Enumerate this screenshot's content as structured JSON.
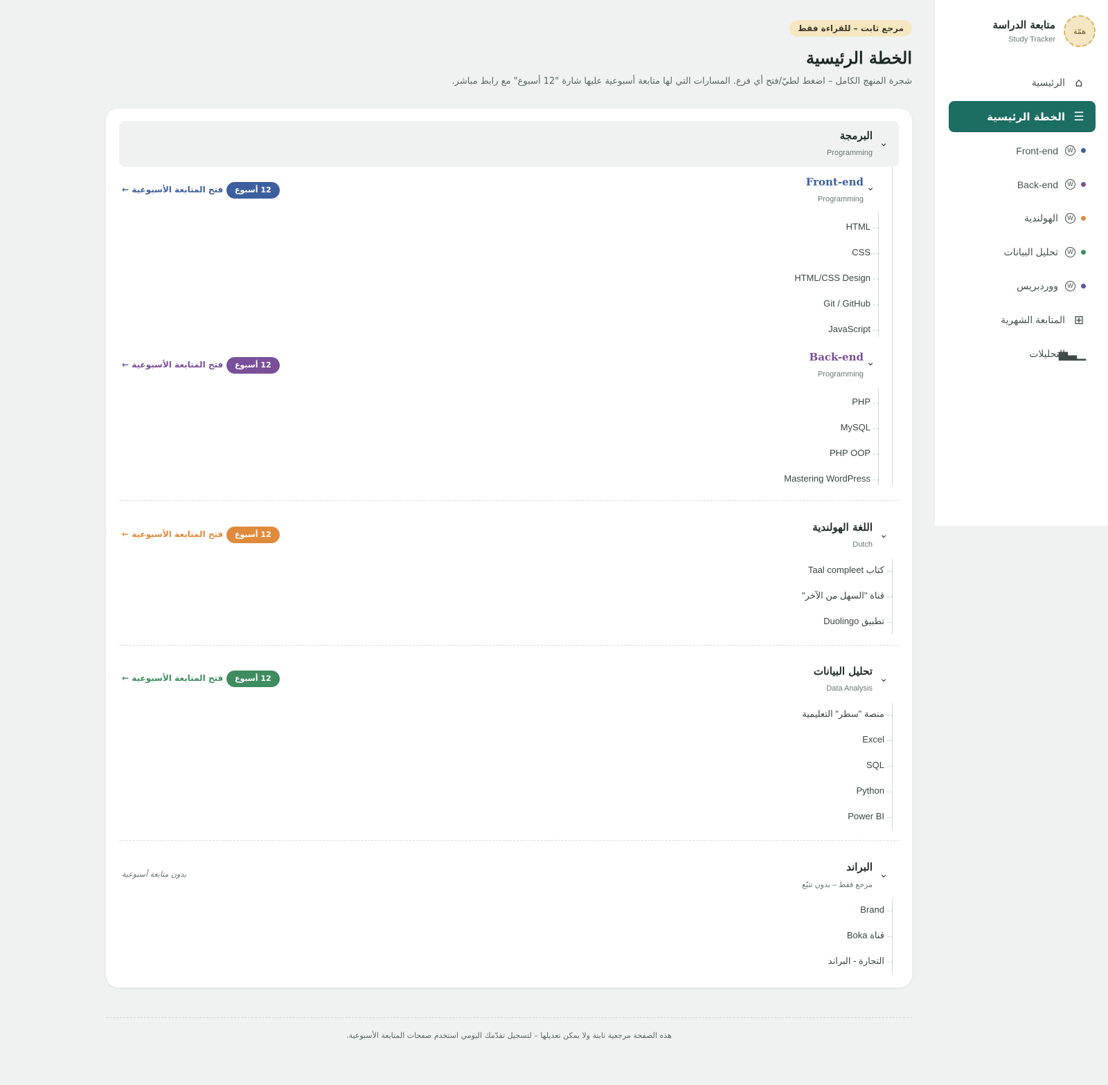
{
  "brand": {
    "logo_text": "همّة",
    "title": "متابعة الدراسة",
    "subtitle": "Study Tracker"
  },
  "nav": [
    {
      "label": "الرئيسية",
      "icon": "home-icon",
      "active": false
    },
    {
      "label": "الخطة الرئيسية",
      "icon": "list-icon",
      "active": true
    },
    {
      "label": "Front-end",
      "icon": "wordpress-icon",
      "dot": "#3d5f9f"
    },
    {
      "label": "Back-end",
      "icon": "wordpress-icon",
      "dot": "#7a4f9a"
    },
    {
      "label": "الهولندية",
      "icon": "wordpress-icon",
      "dot": "#e08a3c"
    },
    {
      "label": "تحليل البيانات",
      "icon": "wordpress-icon",
      "dot": "#3e8c5f"
    },
    {
      "label": "ووردبريس",
      "icon": "wordpress-icon",
      "dot": "#5a56a0"
    },
    {
      "label": "المتابعة الشهرية",
      "icon": "grid-icon"
    },
    {
      "label": "التحليلات",
      "icon": "bar-chart-icon"
    }
  ],
  "header": {
    "badge": "مرجع ثابت – للقراءة فقط",
    "title": "الخطة الرئيسية",
    "description": "شجرة المنهج الكامل – اضغط لطيّ/فتح أي فرع. المسارات التي لها متابعة أسبوعية عليها شارة \"12 أسبوع\" مع رابط مباشر."
  },
  "colors": {
    "accent": "#1c6d62",
    "frontend": "#3d5f9f",
    "backend": "#7a4f9a",
    "dutch": "#e08a3c",
    "data": "#3e8c5f"
  },
  "tree": {
    "programming": {
      "title": "البرمجة",
      "subtitle": "Programming",
      "frontend": {
        "title": "Front-end",
        "subtitle": "Programming",
        "badge": "12 أسبوع",
        "link": "فتح المتابعة الأسبوعية ←",
        "items": [
          "HTML",
          "CSS",
          "HTML/CSS Design",
          "Git / GitHub",
          "JavaScript"
        ]
      },
      "backend": {
        "title": "Back-end",
        "subtitle": "Programming",
        "badge": "12 أسبوع",
        "link": "فتح المتابعة الأسبوعية ←",
        "items": [
          "PHP",
          "MySQL",
          "PHP OOP",
          "Mastering WordPress"
        ]
      }
    },
    "dutch": {
      "title": "اللغة الهولندية",
      "subtitle": "Dutch",
      "badge": "12 أسبوع",
      "link": "فتح المتابعة الأسبوعية ←",
      "items": [
        "كتاب Taal compleet",
        "قناة \"السهل من الآخر\"",
        "تطبيق Duolingo"
      ]
    },
    "data": {
      "title": "تحليل البيانات",
      "subtitle": "Data Analysis",
      "badge": "12 أسبوع",
      "link": "فتح المتابعة الأسبوعية ←",
      "items": [
        "منصة \"سطر\" التعليمية",
        "Excel",
        "SQL",
        "Python",
        "Power BI"
      ]
    },
    "brand": {
      "title": "البراند",
      "subtitle": "مرجع فقط – بدون تتبّع",
      "note": "بدون متابعة أسبوعية",
      "items": [
        "Brand",
        "قناة Boka",
        "التجارة - البراند"
      ]
    }
  },
  "footer": "هذه الصفحة مرجعية ثابتة ولا يمكن تعديلها – لتسجيل تقدّمك اليومي استخدم صفحات المتابعة الأسبوعية."
}
